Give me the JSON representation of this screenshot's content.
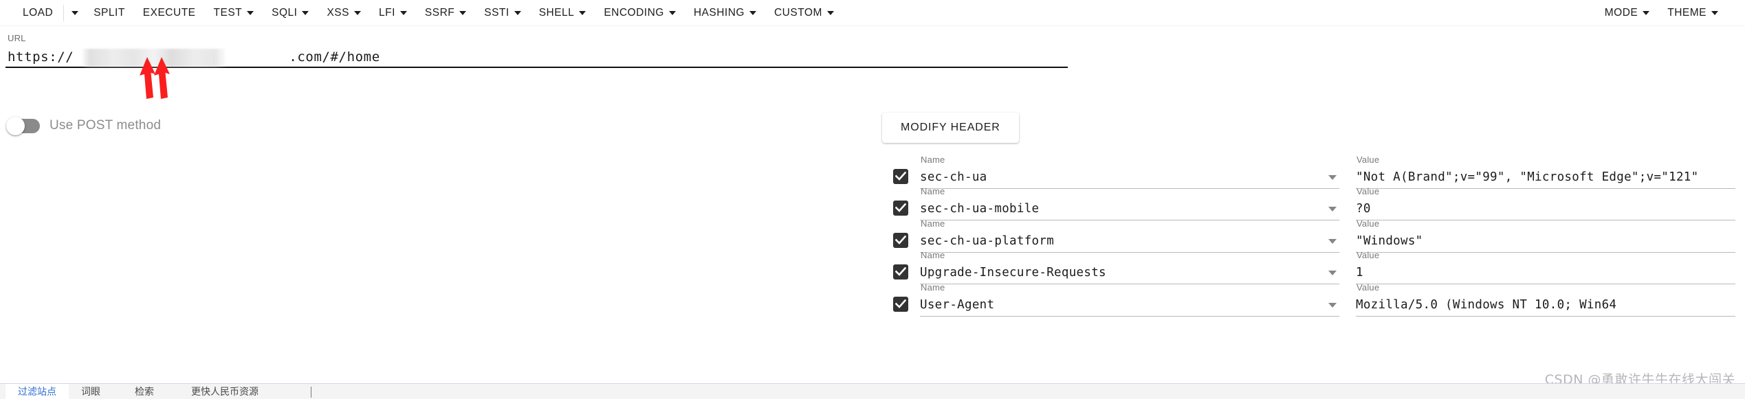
{
  "toolbar": {
    "items": [
      {
        "label": "LOAD",
        "caret": false,
        "icon": ""
      },
      {
        "label": "",
        "caret": true,
        "icon": "chevron-down-icon"
      },
      {
        "label": "SPLIT",
        "caret": false,
        "icon": ""
      },
      {
        "label": "EXECUTE",
        "caret": false,
        "icon": ""
      },
      {
        "label": "TEST",
        "caret": true,
        "icon": "chevron-down-icon"
      },
      {
        "label": "SQLI",
        "caret": true,
        "icon": "chevron-down-icon"
      },
      {
        "label": "XSS",
        "caret": true,
        "icon": "chevron-down-icon"
      },
      {
        "label": "LFI",
        "caret": true,
        "icon": "chevron-down-icon"
      },
      {
        "label": "SSRF",
        "caret": true,
        "icon": "chevron-down-icon"
      },
      {
        "label": "SSTI",
        "caret": true,
        "icon": "chevron-down-icon"
      },
      {
        "label": "SHELL",
        "caret": true,
        "icon": "chevron-down-icon"
      },
      {
        "label": "ENCODING",
        "caret": true,
        "icon": "chevron-down-icon"
      },
      {
        "label": "HASHING",
        "caret": true,
        "icon": "chevron-down-icon"
      },
      {
        "label": "CUSTOM",
        "caret": true,
        "icon": "chevron-down-icon"
      }
    ],
    "right_items": [
      {
        "label": "MODE",
        "caret": true,
        "icon": "chevron-down-icon"
      },
      {
        "label": "THEME",
        "caret": true,
        "icon": "chevron-down-icon"
      }
    ]
  },
  "url": {
    "label": "URL",
    "prefix": "https://",
    "redacted": "                          ",
    "suffix": ".com/#/home",
    "full_visible": "https://                          .com/#/home"
  },
  "post": {
    "label": "Use POST method",
    "enabled": false
  },
  "headers_panel": {
    "modify_button": "MODIFY HEADER",
    "name_label": "Name",
    "value_label": "Value",
    "delete_icon": "×",
    "rows": [
      {
        "checked": true,
        "name": "sec-ch-ua",
        "value": "\"Not A(Brand\";v=\"99\", \"Microsoft Edge\";v=\"121\""
      },
      {
        "checked": true,
        "name": "sec-ch-ua-mobile",
        "value": "?0"
      },
      {
        "checked": true,
        "name": "sec-ch-ua-platform",
        "value": "\"Windows\""
      },
      {
        "checked": true,
        "name": "Upgrade-Insecure-Requests",
        "value": "1"
      },
      {
        "checked": true,
        "name": "User-Agent",
        "value": "Mozilla/5.0 (Windows NT 10.0; Win64"
      }
    ]
  },
  "watermark": "CSDN @勇敢许牛牛在线大闯关",
  "bottom_bar": {
    "tabs": [
      {
        "label": "过滤站点",
        "active": true
      },
      {
        "label": "词眼",
        "active": false
      },
      {
        "label": "检索",
        "active": false
      },
      {
        "label": "更快人民币资源",
        "active": false
      }
    ]
  },
  "colors": {
    "accent": "#2f6fd0",
    "checkbox": "#333333",
    "toggle_track": "#8a8a8a",
    "annotation_red": "#fa1e1e",
    "text": "#1d1d1d",
    "muted": "#7a7a7a"
  }
}
